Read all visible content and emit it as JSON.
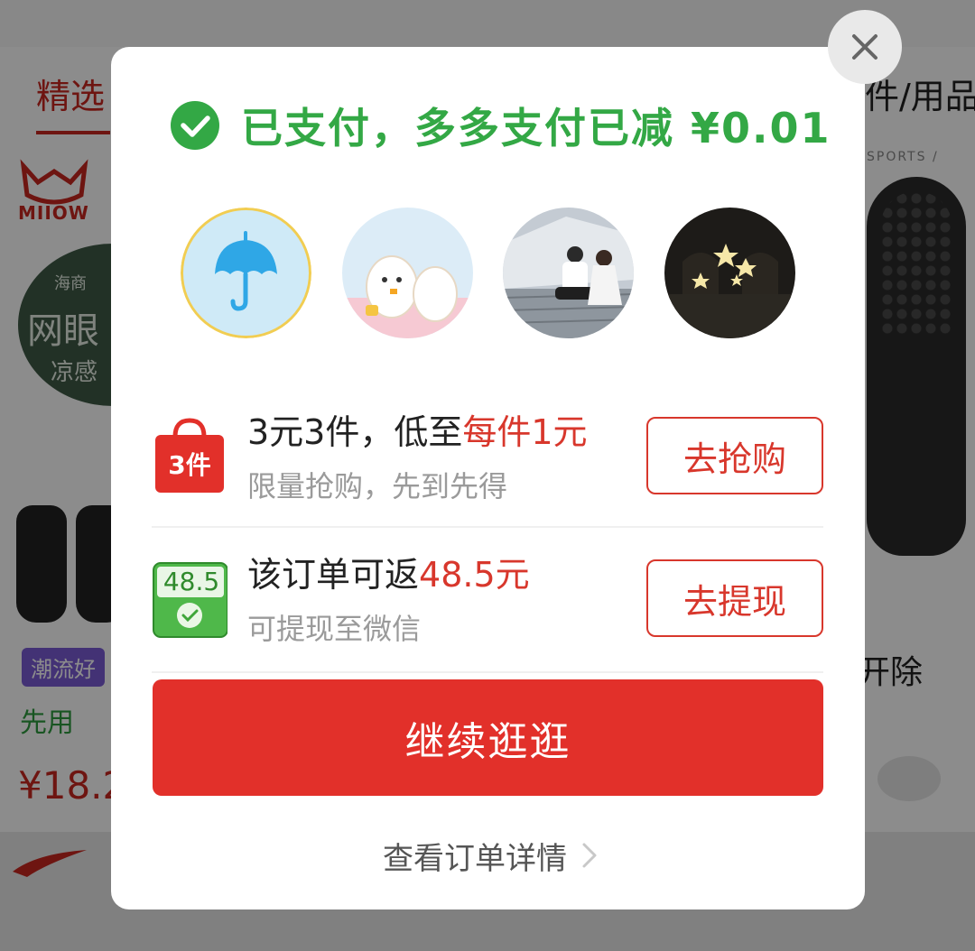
{
  "background": {
    "tab_left": "精选",
    "tab_right": "件/用品",
    "brand_text": "MIIOW",
    "badge_line1": "海商",
    "badge_line2": "网眼",
    "badge_line3": "凉感",
    "tag_label": "潮流好",
    "first_use_label": "先用",
    "price": "¥18.2",
    "sports_text": "SPORTS /",
    "remove_text": "开除"
  },
  "modal": {
    "paid_message": "已支付，多多支付已减 ¥0.01",
    "avatars": [
      {
        "name": "avatar-umbrella",
        "icon": "umbrella-icon"
      },
      {
        "name": "avatar-cartoon",
        "icon": "cartoon-seals"
      },
      {
        "name": "avatar-couple-photo",
        "icon": "photo"
      },
      {
        "name": "avatar-stars",
        "icon": "star-icon"
      }
    ],
    "promo_1": {
      "icon_label": "3件",
      "main_prefix": "3元3件，低至",
      "main_highlight": "每件1元",
      "sub": "限量抢购，先到先得",
      "button": "去抢购"
    },
    "promo_2": {
      "icon_label": "48.5",
      "main_prefix": "该订单可返",
      "main_highlight": "48.5元",
      "sub": "可提现至微信",
      "button": "去提现"
    },
    "continue_button": "继续逛逛",
    "order_detail_link": "查看订单详情"
  },
  "colors": {
    "success_green": "#33a845",
    "accent_red": "#e2302a",
    "highlight_red": "#d8372c"
  }
}
